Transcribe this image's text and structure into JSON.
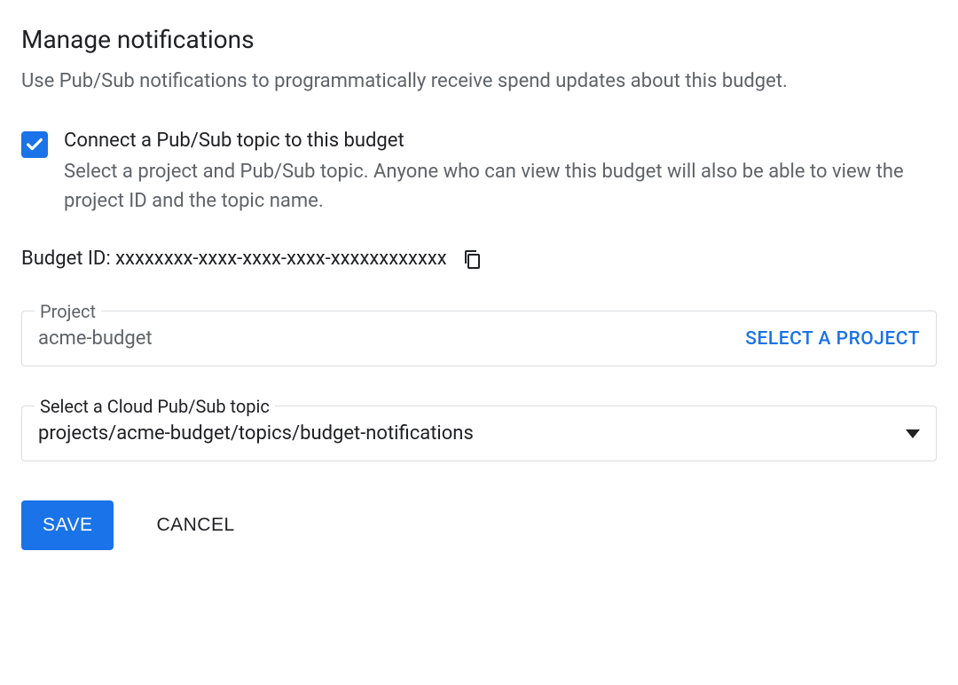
{
  "section": {
    "title": "Manage notifications",
    "description": "Use Pub/Sub notifications to programmatically receive spend updates about this budget."
  },
  "checkbox": {
    "label": "Connect a Pub/Sub topic to this budget",
    "helper": "Select a project and Pub/Sub topic. Anyone who can view this budget will also be able to view the project ID and the topic name.",
    "checked": true
  },
  "budget_id": {
    "label": "Budget ID: ",
    "value": "xxxxxxxx-xxxx-xxxx-xxxx-xxxxxxxxxxxx"
  },
  "project_field": {
    "label": "Project",
    "value": "acme-budget",
    "action": "SELECT A PROJECT"
  },
  "topic_field": {
    "label": "Select a Cloud Pub/Sub topic",
    "value": "projects/acme-budget/topics/budget-notifications"
  },
  "buttons": {
    "save": "SAVE",
    "cancel": "CANCEL"
  }
}
